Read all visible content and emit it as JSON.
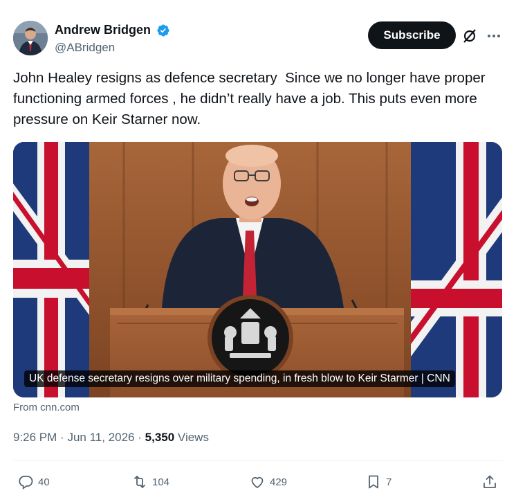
{
  "author": {
    "display_name": "Andrew Bridgen",
    "handle": "@ABridgen"
  },
  "header": {
    "subscribe_label": "Subscribe"
  },
  "tweet": {
    "text": "John Healey resigns as defence secretary  Since we no longer have proper functioning armed forces , he didn’t really have a job. This puts even more pressure on Keir Starner now."
  },
  "link_card": {
    "caption": "UK defense secretary resigns over military spending, in fresh blow to Keir Starmer | CNN",
    "source": "From cnn.com"
  },
  "meta": {
    "time": "9:26 PM",
    "separator": "·",
    "date": "Jun 11, 2026",
    "views_count": "5,350",
    "views_label": "Views"
  },
  "actions": {
    "replies": "40",
    "reposts": "104",
    "likes": "429",
    "bookmarks": "7"
  },
  "icons": [
    "verified-badge-icon",
    "grok-icon",
    "more-icon",
    "reply-icon",
    "repost-icon",
    "like-icon",
    "bookmark-icon",
    "share-icon"
  ],
  "colors": {
    "verified_blue": "#1d9bf0",
    "text_primary": "#0f1419",
    "text_secondary": "#536471",
    "button_dark": "#0f1419"
  }
}
